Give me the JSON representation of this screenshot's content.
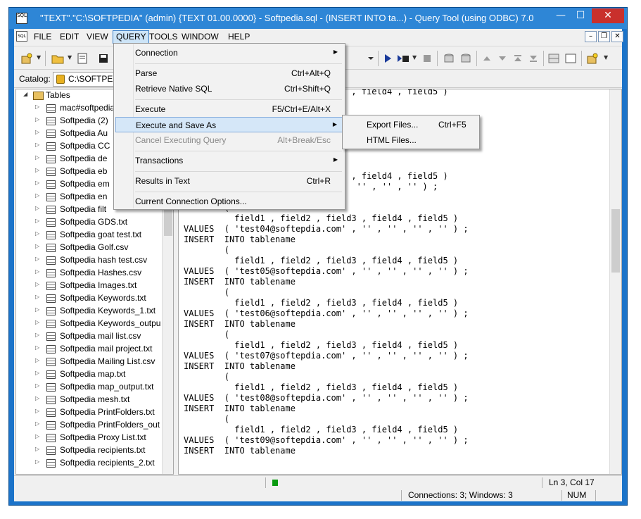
{
  "window": {
    "title": "\"TEXT\".\"C:\\SOFTPEDIA\" (admin) {TEXT 01.00.0000} - Softpedia.sql - (INSERT  INTO ta...) - Query Tool (using ODBC) 7.0",
    "icon_label": "SQL",
    "minimize_glyph": "—",
    "maximize_glyph": "☐",
    "close_glyph": "✕"
  },
  "menubar": {
    "items": [
      "FILE",
      "EDIT",
      "VIEW",
      "QUERY",
      "TOOLS",
      "WINDOW",
      "HELP"
    ],
    "active": "QUERY",
    "mdi_min": "–",
    "mdi_restore": "❐",
    "mdi_close": "✕"
  },
  "catalog": {
    "label": "Catalog:",
    "value": "C:\\SOFTPEDIA"
  },
  "tree": {
    "root": "Tables",
    "items": [
      "mac#softpedia",
      "Softpedia (2)",
      "Softpedia Au",
      "Softpedia CC",
      "Softpedia de",
      "Softpedia eb",
      "Softpedia em",
      "Softpedia en",
      "Softpedia filt",
      "Softpedia GDS.txt",
      "Softpedia goat test.txt",
      "Softpedia Golf.csv",
      "Softpedia hash test.csv",
      "Softpedia Hashes.csv",
      "Softpedia Images.txt",
      "Softpedia Keywords.txt",
      "Softpedia Keywords_1.txt",
      "Softpedia Keywords_outpu",
      "Softpedia mail list.csv",
      "Softpedia mail project.txt",
      "Softpedia Mailing List.csv",
      "Softpedia map.txt",
      "Softpedia map_output.txt",
      "Softpedia mesh.txt",
      "Softpedia PrintFolders.txt",
      "Softpedia PrintFolders_out",
      "Softpedia Proxy List.txt",
      "Softpedia recipients.txt",
      "Softpedia recipients_2.txt"
    ]
  },
  "editor": {
    "lines": [
      "                                 , field4 , field5 )",
      "",
      "",
      "",
      "                                 , field4 , field5 )",
      "                                  '' , '' , '' ) ;",
      "",
      "",
      "                                 , field4 , field5 )",
      "                                  '' , '' , '' ) ;",
      "INSERT  INTO tablename",
      "        (",
      "          field1 , field2 , field3 , field4 , field5 )",
      "VALUES  ( 'test04@softepdia.com' , '' , '' , '' , '' ) ;",
      "INSERT  INTO tablename",
      "        (",
      "          field1 , field2 , field3 , field4 , field5 )",
      "VALUES  ( 'test05@softepdia.com' , '' , '' , '' , '' ) ;",
      "INSERT  INTO tablename",
      "        (",
      "          field1 , field2 , field3 , field4 , field5 )",
      "VALUES  ( 'test06@softepdia.com' , '' , '' , '' , '' ) ;",
      "INSERT  INTO tablename",
      "        (",
      "          field1 , field2 , field3 , field4 , field5 )",
      "VALUES  ( 'test07@softepdia.com' , '' , '' , '' , '' ) ;",
      "INSERT  INTO tablename",
      "        (",
      "          field1 , field2 , field3 , field4 , field5 )",
      "VALUES  ( 'test08@softepdia.com' , '' , '' , '' , '' ) ;",
      "INSERT  INTO tablename",
      "        (",
      "          field1 , field2 , field3 , field4 , field5 )",
      "VALUES  ( 'test09@softepdia.com' , '' , '' , '' , '' ) ;",
      "INSERT  INTO tablename"
    ]
  },
  "query_menu": {
    "items": [
      {
        "label": "Connection",
        "shortcut": "",
        "submenu": true,
        "highlighted": false,
        "disabled": false
      },
      {
        "label": "Parse",
        "shortcut": "Ctrl+Alt+Q",
        "submenu": false,
        "highlighted": false,
        "disabled": false
      },
      {
        "label": "Retrieve Native SQL",
        "shortcut": "Ctrl+Shift+Q",
        "submenu": false,
        "highlighted": false,
        "disabled": false
      },
      {
        "label": "Execute",
        "shortcut": "F5/Ctrl+E/Alt+X",
        "submenu": false,
        "highlighted": false,
        "disabled": false
      },
      {
        "label": "Execute and Save As",
        "shortcut": "",
        "submenu": true,
        "highlighted": true,
        "disabled": false
      },
      {
        "label": "Cancel Executing Query",
        "shortcut": "Alt+Break/Esc",
        "submenu": false,
        "highlighted": false,
        "disabled": true
      },
      {
        "label": "Transactions",
        "shortcut": "",
        "submenu": true,
        "highlighted": false,
        "disabled": false
      },
      {
        "label": "Results in Text",
        "shortcut": "Ctrl+R",
        "submenu": false,
        "highlighted": false,
        "disabled": false
      },
      {
        "label": "Current Connection Options...",
        "shortcut": "",
        "submenu": false,
        "highlighted": false,
        "disabled": false
      }
    ],
    "submenu_arrow": "▶"
  },
  "save_as_submenu": {
    "items": [
      {
        "label": "Export Files...",
        "shortcut": "Ctrl+F5"
      },
      {
        "label": "HTML Files...",
        "shortcut": ""
      }
    ]
  },
  "status": {
    "position": "Ln 3, Col 17",
    "connections": "Connections: 3; Windows: 3",
    "num": "NUM"
  },
  "colors": {
    "title_bar": "#2e86d6",
    "close_button": "#c9302c",
    "menu_highlight": "#d5e7f8",
    "status_indicator": "#0a9a10"
  },
  "icons": {
    "tree_expand": "▷",
    "tree_root_expand": "◢",
    "chevron_right": "▶",
    "dropdown": "▼"
  }
}
